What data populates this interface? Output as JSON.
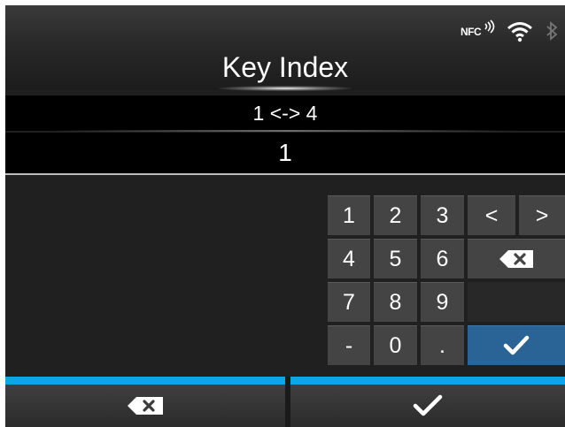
{
  "header": {
    "title": "Key Index",
    "status": {
      "nfc_label": "NFC",
      "icons": [
        "nfc-icon",
        "wifi-icon",
        "bluetooth-icon"
      ]
    }
  },
  "input": {
    "range": "1 <-> 4",
    "value": "1"
  },
  "keypad": {
    "keys": [
      [
        "1",
        "2",
        "3"
      ],
      [
        "4",
        "5",
        "6"
      ],
      [
        "7",
        "8",
        "9"
      ],
      [
        "-",
        "0",
        "."
      ]
    ],
    "cursor_left": "<",
    "cursor_right": ">",
    "backspace_icon": "backspace-icon",
    "enter_icon": "check-icon"
  },
  "footer": {
    "cancel_icon": "backspace-icon",
    "confirm_icon": "check-icon"
  },
  "colors": {
    "accent": "#0aa6e6",
    "confirm": "#2a6496",
    "key": "#444444",
    "background": "#1f1f1f"
  }
}
